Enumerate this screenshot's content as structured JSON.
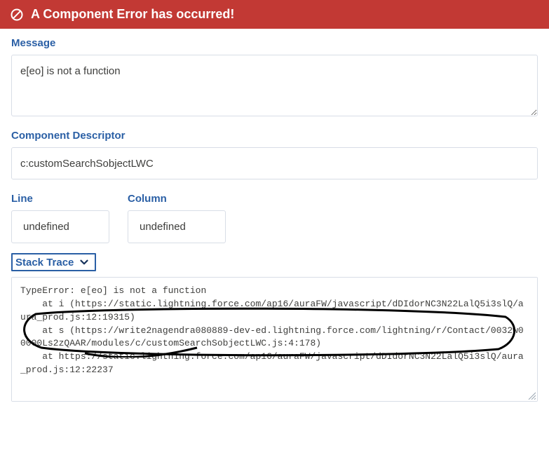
{
  "banner": {
    "title": "A Component Error has occurred!"
  },
  "labels": {
    "message": "Message",
    "componentDescriptor": "Component Descriptor",
    "line": "Line",
    "column": "Column",
    "stackTrace": "Stack Trace"
  },
  "values": {
    "message": "e[eo] is not a function",
    "componentDescriptor": "c:customSearchSobjectLWC",
    "line": "undefined",
    "column": "undefined",
    "stackTrace": "TypeError: e[eo] is not a function\n    at i (https://static.lightning.force.com/ap16/auraFW/javascript/dDIdorNC3N22LalQ5i3slQ/aura_prod.js:12:19315)\n    at s (https://write2nagendra080889-dev-ed.lightning.force.com/lightning/r/Contact/0032w00000Ls2zQAAR/modules/c/customSearchSobjectLWC.js:4:178)\n    at https://static.lightning.force.com/ap16/auraFW/javascript/dDIdorNC3N22LalQ5i3slQ/aura_prod.js:12:22237"
  },
  "colors": {
    "errorRed": "#c23934",
    "linkBlue": "#2a5fa5"
  }
}
